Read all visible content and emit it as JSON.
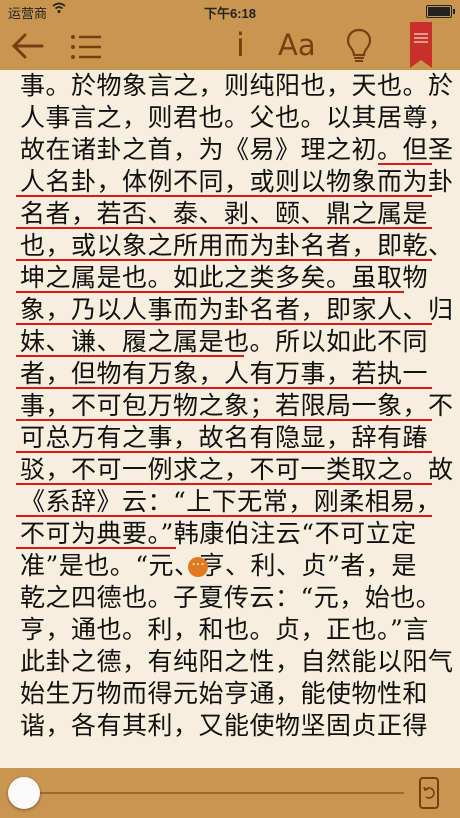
{
  "status_bar": {
    "carrier": "运营商",
    "time": "下午6:18"
  },
  "toolbar": {
    "info_label": "i",
    "font_label": "Aa"
  },
  "reader": {
    "lines": [
      "事。於物象言之，则纯阳也，天也。於",
      "人事言之，则君也。父也。以其居尊，",
      "故在诸卦之首，为《易》理之初。但圣",
      "人名卦，体例不同，或则以物象而为卦",
      "名者，若否、泰、剥、颐、鼎之属是",
      "也，或以象之所用而为卦名者，即乾、",
      "坤之属是也。如此之类多矣。虽取物",
      "象，乃以人事而为卦名者，即家人、归",
      "妹、谦、履之属是也。所以如此不同",
      "者，但物有万象，人有万事，若执一",
      "事，不可包万物之象；若限局一象，不",
      "可总万有之事，故名有隐显，辞有踳",
      "驳，不可一例求之，不可一类取之。故",
      "《系辞》云：“上下无常，刚柔相易，",
      "不可为典要。”韩康伯注云“不可立定",
      "准”是也。“元、亨、利、贞”者，是",
      "乾之四德也。子夏传云：“元，始也。",
      "亨，通也。利，和也。贞，正也。”言",
      "此卦之德，有纯阳之性，自然能以阳气",
      "始生万物而得元始亨通，能使物性和",
      "谐，各有其利，又能使物坚固贞正得"
    ],
    "note_marker": "···"
  },
  "progress": {
    "value": 0.0
  },
  "colors": {
    "toolbar_bg": "#c9964f",
    "page_bg": "#f7efdd",
    "icon_color": "#7a3d12",
    "highlight_underline": "#d81b1b",
    "bookmark": "#c8312a"
  }
}
